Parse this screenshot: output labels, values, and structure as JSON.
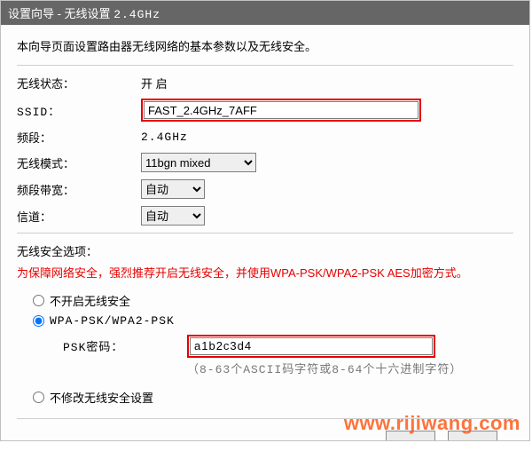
{
  "title": {
    "prefix": "设置向导 - 无线设置",
    "band": "2.4GHz"
  },
  "intro": "本向导页面设置路由器无线网络的基本参数以及无线安全。",
  "labels": {
    "wireless_status": "无线状态：",
    "ssid": "SSID：",
    "band": "频段：",
    "wireless_mode": "无线模式：",
    "bandwidth": "频段带宽：",
    "channel": "信道：",
    "psk": "PSK密码："
  },
  "values": {
    "wireless_status": "开 启",
    "ssid": "FAST_2.4GHz_7AFF",
    "band": "2.4GHz",
    "wireless_mode": "11bgn mixed",
    "bandwidth": "自动",
    "channel": "自动",
    "psk": "a1b2c3d4"
  },
  "security": {
    "title": "无线安全选项：",
    "warning": "为保障网络安全，强烈推荐开启无线安全，并使用WPA-PSK/WPA2-PSK AES加密方式。",
    "options": {
      "disable": "不开启无线安全",
      "wpa": "WPA-PSK/WPA2-PSK",
      "keep": "不修改无线安全设置"
    },
    "selected": "wpa",
    "hint": "（8-63个ASCII码字符或8-64个十六进制字符）"
  },
  "watermark": "www.rijiwang.com"
}
